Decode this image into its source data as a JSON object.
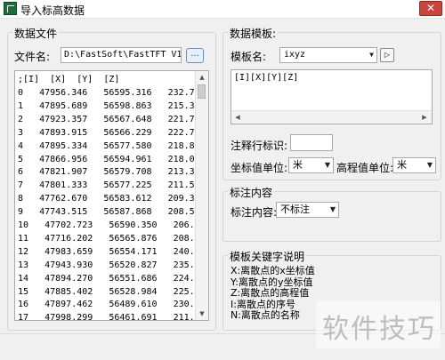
{
  "window": {
    "title": "导入标高数据",
    "close_symbol": "✕"
  },
  "data_file": {
    "group_label": "数据文件",
    "file_label": "文件名:",
    "file_path": "D:\\FastSoft\\FastTFT V12.",
    "browse_label": "...",
    "header": ";[I]  [X]  [Y]  [Z]",
    "rows": [
      "0   47956.346   56595.316   232.700",
      "1   47895.689   56598.863   215.300",
      "2   47923.357   56567.648   221.700",
      "3   47893.915   56566.229   222.700",
      "4   47895.334   56577.580   218.800",
      "5   47866.956   56594.961   218.000",
      "6   47821.907   56579.708   213.300",
      "7   47801.333   56577.225   211.500",
      "8   47762.670   56583.612   209.300",
      "9   47743.515   56587.868   208.500",
      "10   47702.723   56590.350   206.900",
      "11   47716.202   56565.876   208.600",
      "12   47983.659   56554.171   240.500",
      "13   47943.930   56520.827   235.300",
      "14   47894.270   56551.686   224.200",
      "15   47885.402   56528.984   225.800",
      "16   47897.462   56489.610   230.500",
      "17   47998.299   56461.691   211.400"
    ]
  },
  "template": {
    "group_label": "数据模板:",
    "name_label": "模板名:",
    "name_value": "ixyz",
    "next_symbol": "▷",
    "format_text": "[I][X][Y][Z]",
    "comment_label": "注释行标识:",
    "comment_value": "",
    "coord_unit_label": "坐标值单位:",
    "coord_unit_value": "米",
    "elev_unit_label": "高程值单位:",
    "elev_unit_value": "米"
  },
  "annotation": {
    "group_label": "标注内容",
    "content_label": "标注内容:",
    "content_value": "不标注"
  },
  "keywords": {
    "group_label": "模板关键字说明",
    "items": [
      "X:离散点的x坐标值",
      "Y:离散点的y坐标值",
      "Z:离散点的高程值",
      "I:离散点的序号",
      "N:离散点的名称"
    ]
  },
  "watermark": "软件技巧",
  "colors": {
    "close_button": "#c9443a",
    "app_icon": "#1f6b3a",
    "browse_button": "#e6f0fb"
  }
}
